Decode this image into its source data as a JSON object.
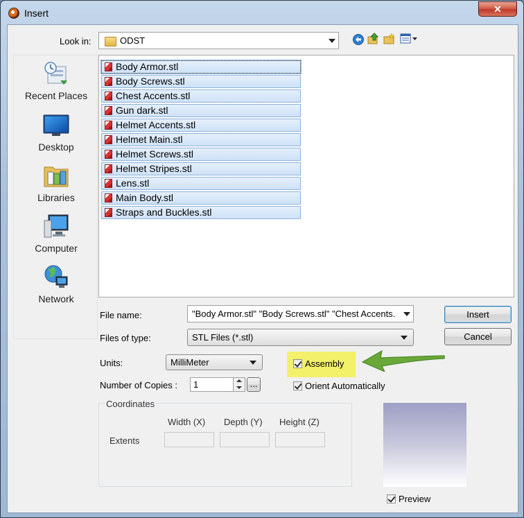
{
  "window": {
    "title": "Insert",
    "close_glyph": "✕"
  },
  "lookin": {
    "label": "Look in:",
    "value": "ODST"
  },
  "toolbar": {
    "icons": [
      "back-icon",
      "up-folder-icon",
      "new-folder-icon",
      "view-menu-icon"
    ]
  },
  "places": [
    {
      "label": "Recent Places",
      "icon": "recent-places-icon"
    },
    {
      "label": "Desktop",
      "icon": "desktop-icon"
    },
    {
      "label": "Libraries",
      "icon": "libraries-icon"
    },
    {
      "label": "Computer",
      "icon": "computer-icon"
    },
    {
      "label": "Network",
      "icon": "network-icon"
    }
  ],
  "files": [
    "Body Armor.stl",
    "Body Screws.stl",
    "Chest Accents.stl",
    "Gun dark.stl",
    "Helmet Accents.stl",
    "Helmet Main.stl",
    "Helmet Screws.stl",
    "Helmet Stripes.stl",
    "Lens.stl",
    "Main Body.stl",
    "Straps and Buckles.stl"
  ],
  "filename": {
    "label": "File name:",
    "value": "\"Body Armor.stl\" \"Body Screws.stl\" \"Chest Accents."
  },
  "filetype": {
    "label": "Files of type:",
    "value": "STL Files (*.stl)"
  },
  "buttons": {
    "insert": "Insert",
    "cancel": "Cancel",
    "browse": "..."
  },
  "units": {
    "label": "Units:",
    "value": "MilliMeter"
  },
  "copies": {
    "label": "Number of Copies :",
    "value": "1"
  },
  "assembly": {
    "label": "Assembly",
    "checked": true
  },
  "orient": {
    "label": "Orient Automatically",
    "checked": true
  },
  "coordinates": {
    "title": "Coordinates",
    "width": "Width (X)",
    "depth": "Depth (Y)",
    "height": "Height (Z)",
    "extents": "Extents"
  },
  "preview": {
    "label": "Preview",
    "checked": true
  },
  "colors": {
    "highlight": "#f3f06a",
    "arrow": "#6aa83a",
    "selection": "#cfe2f7"
  }
}
